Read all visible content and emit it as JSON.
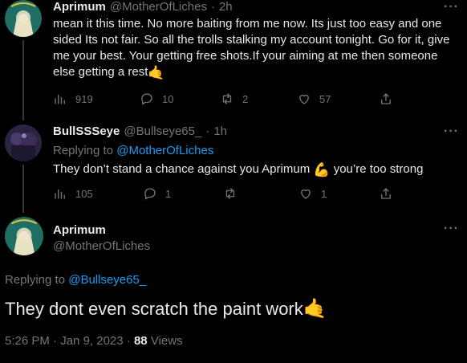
{
  "tweet1": {
    "display_name": "Aprimum",
    "handle": "@MotherOfLiches",
    "sep": "·",
    "time": "2h",
    "text": "mean it this time. No more baiting from me now. Its just too easy and one sided Its not fair. So all the trolls stalking my account tonight.  Go for it, give me your best. Your getting free shots.If your aiming at me then someone else getting a rest",
    "emoji": "🤙",
    "views": "919",
    "replies": "10",
    "retweets": "2",
    "likes": "57"
  },
  "tweet2": {
    "display_name": "BullSSSeye",
    "handle": "@Bullseye65_",
    "sep": "·",
    "time": "1h",
    "replying_prefix": "Replying to",
    "replying_to": "@MotherOfLiches",
    "text_before": "They don’t stand a chance against you Aprimum",
    "emoji": "💪",
    "text_after": "you’re too strong",
    "views": "105",
    "replies": "1",
    "retweets": "",
    "likes": "1"
  },
  "focused": {
    "display_name": "Aprimum",
    "handle": "@MotherOfLiches",
    "replying_prefix": "Replying to",
    "replying_to": "@Bullseye65_",
    "text": "They dont even scratch the paint work",
    "emoji": "🤙",
    "time": "5:26 PM",
    "date_sep": "·",
    "date": "Jan 9, 2023",
    "views_sep": "·",
    "views_count": "88",
    "views_label": "Views"
  },
  "ui": {
    "more_label": "···"
  },
  "colors": {
    "background": "#000000",
    "text": "#e7e9ea",
    "secondary": "#71767b",
    "link": "#1d9bf0",
    "avatar_aprimum": "#1f6e63",
    "avatar_bull": "#2a2440"
  },
  "icons": [
    "views-icon",
    "reply-icon",
    "retweet-icon",
    "like-icon",
    "share-icon",
    "more-icon"
  ]
}
